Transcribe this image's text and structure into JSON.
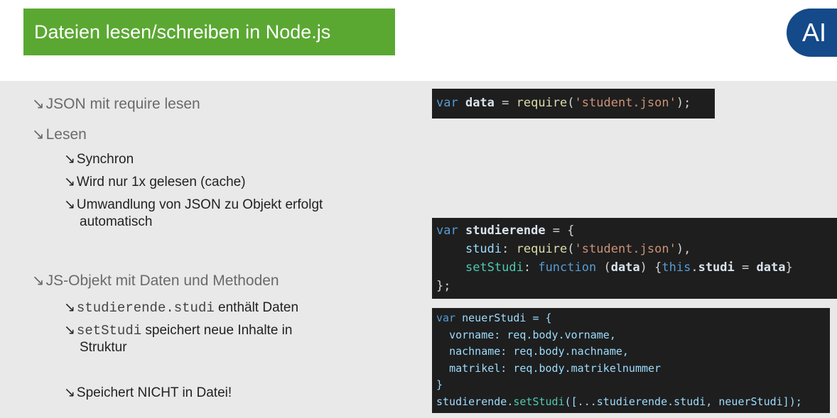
{
  "slide": {
    "title": "Dateien lesen/schreiben in Node.js",
    "logo_text": "AI"
  },
  "bullets": {
    "arrow": "↘",
    "json_require": "JSON mit require lesen",
    "lesen": "Lesen",
    "synchron": "Synchron",
    "cache": "Wird nur 1x gelesen (cache)",
    "umwandlung_line1": "Umwandlung von JSON zu Objekt erfolgt",
    "umwandlung_line2": "automatisch",
    "js_objekt": "JS-Objekt mit Daten und Methoden",
    "studi_code": "studierende.studi",
    "studi_text": " enthält Daten",
    "setstudi_code": "setStudi",
    "setstudi_text_line1": " speichert neue Inhalte in",
    "setstudi_text_line2": "Struktur",
    "nicht_datei": "Speichert NICHT in Datei!"
  },
  "code": {
    "block1": {
      "var": "var",
      "name": "data",
      "eq": " = ",
      "fn": "require",
      "open": "(",
      "str": "'student.json'",
      "close": ");"
    },
    "block2": {
      "l1_var": "var",
      "l1_name": "studierende",
      "l1_rest": " = {",
      "l2_prop": "studi",
      "l2_colon": ": ",
      "l2_fn": "require",
      "l2_open": "(",
      "l2_str": "'student.json'",
      "l2_close": "),",
      "l3_prop": "setStudi",
      "l3_colon": ": ",
      "l3_kw": "function",
      "l3_paren": " (",
      "l3_arg": "data",
      "l3_mid": ") {",
      "l3_this": "this",
      "l3_dot": ".",
      "l3_studi": "studi",
      "l3_eq": " = ",
      "l3_data": "data",
      "l3_end": "}",
      "l4": "};"
    },
    "block3": {
      "l1_var": "var",
      "l1_rest": " neuerStudi = {",
      "l2": "vorname: req.body.vorname,",
      "l3": "nachname: req.body.nachname,",
      "l4": "matrikel: req.body.matrikelnummer",
      "l5": "}",
      "l6_obj": "studierende",
      "l6_dot": ".",
      "l6_fn": "setStudi",
      "l6_rest": "([...studierende.studi, neuerStudi]);"
    }
  },
  "colors": {
    "title_bg": "#5aa832",
    "logo_bg": "#144a8a",
    "content_bg": "#e8e9e8",
    "code_bg": "#1e1e1e"
  }
}
